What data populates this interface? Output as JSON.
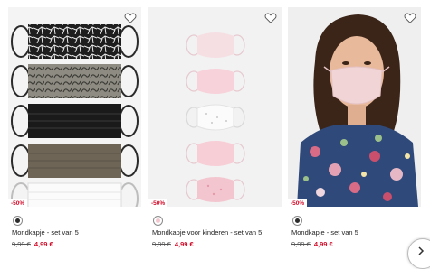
{
  "products": [
    {
      "name": "Mondkapje - set van 5",
      "old_price": "9,99 €",
      "new_price": "4,99 €",
      "discount": "-50%",
      "image_desc": "five-face-masks-patterned-grey-black-brown-white",
      "swatch_color": "#2b2b2b"
    },
    {
      "name": "Mondkapje voor kinderen - set van 5",
      "old_price": "9,99 €",
      "new_price": "4,99 €",
      "discount": "-50%",
      "image_desc": "five-pink-white-kids-face-masks",
      "swatch_color": "#f3c6cf"
    },
    {
      "name": "Mondkapje - set van 5",
      "old_price": "9,99 €",
      "new_price": "4,99 €",
      "discount": "-50%",
      "image_desc": "woman-wearing-pink-mask-floral-top",
      "swatch_color": "#2b2b2b"
    }
  ],
  "colors": {
    "sale_red": "#d30e2b",
    "text": "#222222",
    "image_bg": "#f2f2f2"
  },
  "icons": {
    "wishlist": "heart-outline-icon",
    "next": "chevron-right-icon"
  }
}
